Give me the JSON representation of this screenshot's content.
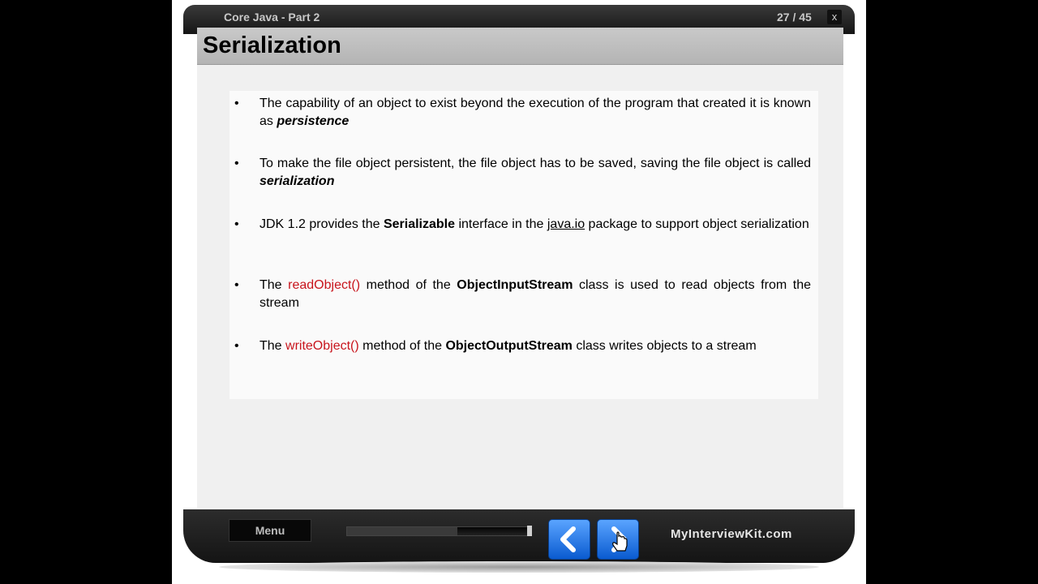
{
  "window": {
    "title": "Core Java - Part 2",
    "counter": "27 / 45",
    "close_label": "x"
  },
  "slide": {
    "title": "Serialization",
    "bullets": [
      {
        "symbol": "•",
        "p1": "The capability of an object to exist beyond the execution of the program that created it is known as ",
        "p2": "persistence"
      },
      {
        "symbol": "•",
        "p1": "To make the file object persistent, the file object has to be saved,  saving the file object is called ",
        "p2": "serialization"
      },
      {
        "symbol": "•",
        "p1": "JDK 1.2 provides the ",
        "p2": "Serializable",
        "p3": " interface in the ",
        "p4": "java.io",
        "p5": " package to support object serialization"
      },
      {
        "symbol": "•",
        "p1": "The ",
        "p2": "readObject()",
        "p3": " method of the ",
        "p4": "ObjectInputStream",
        "p5": " class is used to read objects from the stream"
      },
      {
        "symbol": "•",
        "p1": "The ",
        "p2": "writeObject()",
        "p3": " method of the ",
        "p4": "ObjectOutputStream",
        "p5": " class writes objects to a stream"
      }
    ]
  },
  "controls": {
    "menu_label": "Menu",
    "progress_fraction": 0.6,
    "prev_icon": "chevron-left-icon",
    "next_icon": "chevron-right-icon",
    "cursor_icon": "hand-pointer-icon",
    "brand": "MyInterviewKit.com"
  },
  "colors": {
    "accent_blue": "#1a6fe0",
    "method_red": "#c8141c",
    "header_gray": "#c0c0c0"
  }
}
